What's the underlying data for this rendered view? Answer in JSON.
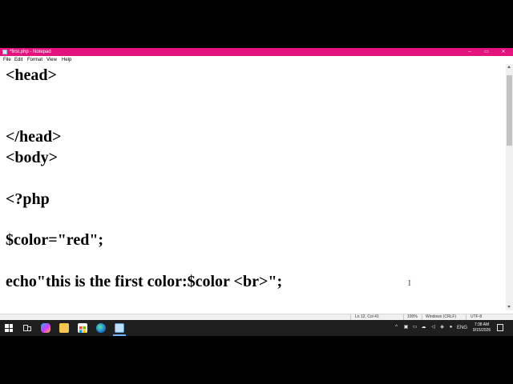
{
  "window": {
    "title": "*first.php - Notepad",
    "controls": {
      "minimize": "‒",
      "maximize": "▭",
      "close": "✕"
    }
  },
  "menu": [
    "File",
    "Edit",
    "Format",
    "View",
    "Help"
  ],
  "editor": {
    "lines": [
      "<head>",
      "</head>",
      "<body>",
      "<?php",
      "$color=\"red\";",
      "echo\"this is the first color:$color <br>\";"
    ],
    "cursor_glyph": "I"
  },
  "status": {
    "position": "Ln 12, Col 41",
    "zoom": "100%",
    "line_endings": "Windows (CRLF)",
    "encoding": "UTF-8"
  },
  "taskbar": {
    "icons": [
      "start-icon",
      "task-view-icon",
      "copilot-icon",
      "file-explorer-icon",
      "store-icon",
      "edge-icon",
      "notepad-icon"
    ],
    "tray": {
      "chevron": "^",
      "language": "ENG",
      "time": "7:38 AM",
      "date": "9/15/2026"
    }
  },
  "colors": {
    "titlebar_accent": "#e3127c",
    "taskbar": "#1f1f1f"
  }
}
